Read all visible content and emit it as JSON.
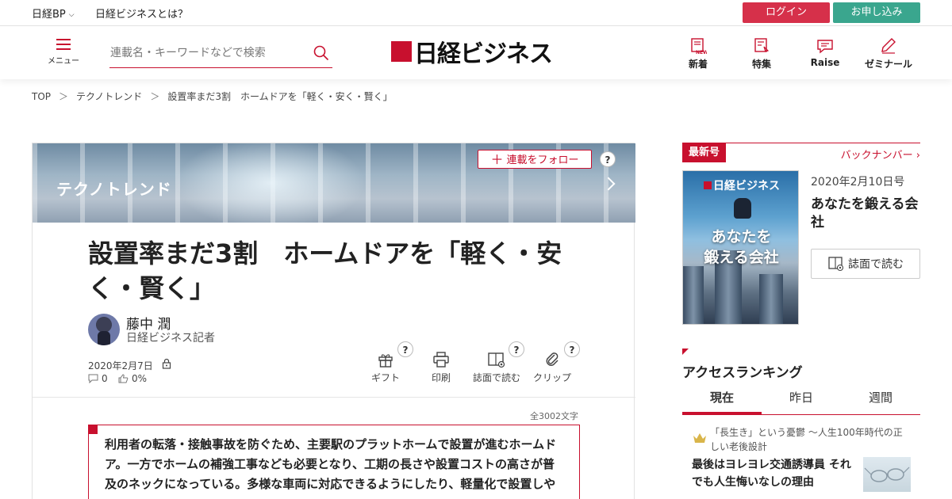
{
  "topbar": {
    "brand": "日経BP",
    "about": "日経ビジネスとは？",
    "login": "ログイン",
    "signup": "お申し込み",
    "login_color": "#d6304a",
    "signup_color": "#3aa68e"
  },
  "header": {
    "menu_label": "メニュー",
    "search_placeholder": "連載名・キーワードなどで検索",
    "logo_text": "日経ビジネス",
    "nav": [
      {
        "label": "新着",
        "icon": "new-icon"
      },
      {
        "label": "特集",
        "icon": "feature-icon"
      },
      {
        "label": "Raise",
        "icon": "raise-icon"
      },
      {
        "label": "ゼミナール",
        "icon": "seminar-icon"
      }
    ],
    "accent": "#c8102e"
  },
  "breadcrumb": {
    "items": [
      "TOP",
      "テクノトレンド",
      "設置率まだ3割　ホームドアを「軽く・安く・賢く」"
    ],
    "separator": "＞"
  },
  "article": {
    "series": "テクノトレンド",
    "follow": "連載をフォロー",
    "help": "?",
    "title": "設置率まだ3割　ホームドアを「軽く・安く・賢く」",
    "author_name": "藤中 潤",
    "author_role": "日経ビジネス記者",
    "date": "2020年2月7日",
    "comments": "0",
    "likes": "0%",
    "tools": [
      {
        "label": "ギフト",
        "icon": "gift-icon"
      },
      {
        "label": "印刷",
        "icon": "print-icon"
      },
      {
        "label": "誌面で読む",
        "icon": "magazine-icon"
      },
      {
        "label": "クリップ",
        "icon": "clip-icon"
      }
    ],
    "word_count": "全3002文字",
    "lead_lines": [
      "利用者の転落・接触事故を防ぐため、主要駅のプラットホームで設置が進むホームド",
      "ア。一方でホームの補強工事なども必要となり、工期の長さや設置コストの高さが普",
      "及のネックになっている。多様な車両に対応できるようにしたり、軽量化で設置しや"
    ]
  },
  "sidebar": {
    "latest_tag": "最新号",
    "back_numbers": "バックナンバー",
    "cover_logo": "日経ビジネス",
    "cover_title_1": "あなたを",
    "cover_title_2": "鍛える会社",
    "issue_date": "2020年2月10日号",
    "issue_title": "あなたを鍛える会社",
    "read_button": "誌面で読む",
    "ranking_title": "アクセスランキング",
    "ranking_tabs": [
      "現在",
      "昨日",
      "週間"
    ],
    "ranking_first_sub": "「長生き」という憂鬱 ～人生100年時代の正しい老後設計",
    "ranking_first_title": "最後はヨレヨレ交通誘導員 それでも人生悔いなしの理由"
  }
}
